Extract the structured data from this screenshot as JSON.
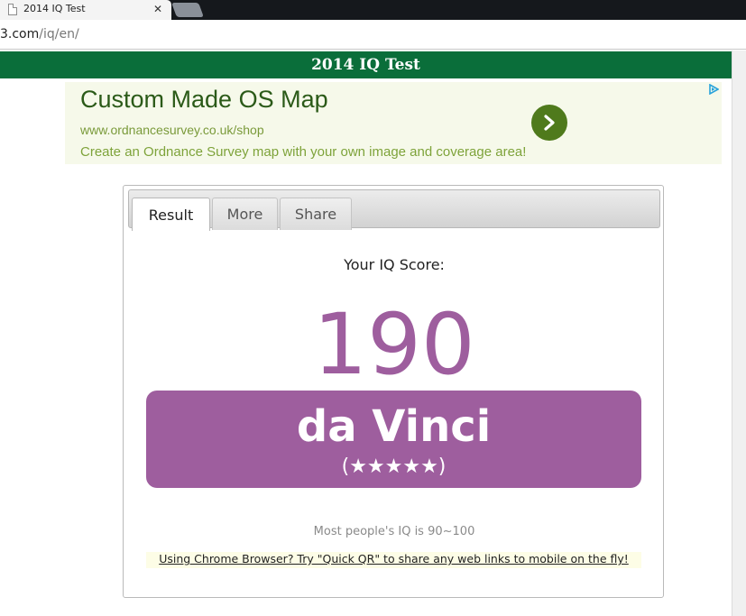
{
  "browser": {
    "tab_title": "2014 IQ Test",
    "tab_close": "✕",
    "url_host": "3.com",
    "url_path": "/iq/en/"
  },
  "header": {
    "title": "2014 IQ Test"
  },
  "ad": {
    "headline": "Custom Made OS Map",
    "url": "www.ordnancesurvey.co.uk/shop",
    "description": "Create an Ordnance Survey map with your own image and coverage area!"
  },
  "tabs": [
    {
      "label": "Result",
      "active": true
    },
    {
      "label": "More",
      "active": false
    },
    {
      "label": "Share",
      "active": false
    }
  ],
  "result": {
    "score_label": "Your IQ Score:",
    "score": "190",
    "rank_name": "da Vinci",
    "rank_stars": "(★★★★★)",
    "stars": 5,
    "note": "Most people's IQ is 90~100",
    "promo": "Using Chrome Browser? Try \"Quick QR\" to share any web links to mobile on the fly!"
  },
  "colors": {
    "header": "#0a6e3a",
    "accent": "#9e5e9e",
    "ad_arrow": "#4f7a1c"
  }
}
